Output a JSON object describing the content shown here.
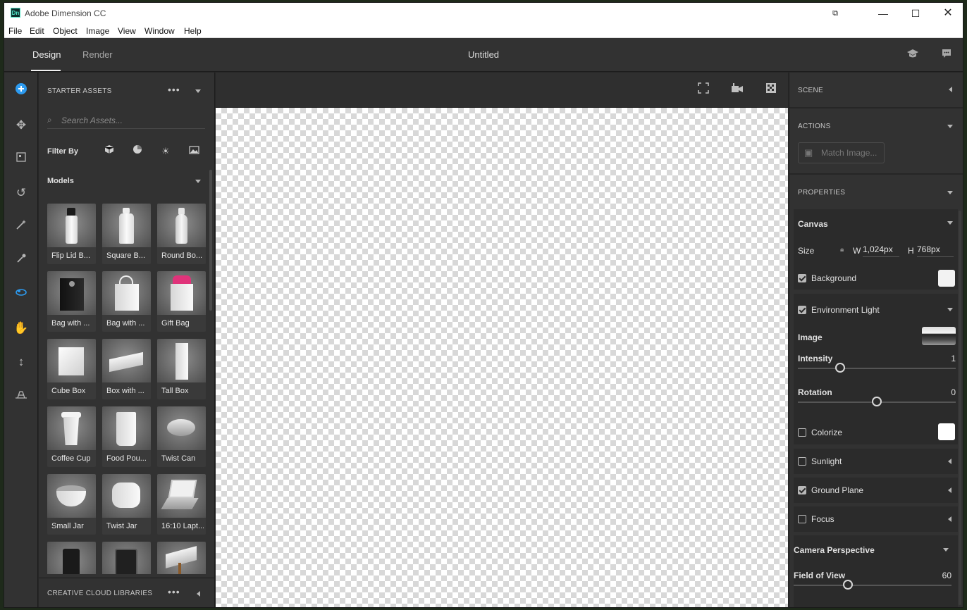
{
  "window": {
    "title": "Adobe Dimension CC",
    "app_badge": "Dn"
  },
  "menu": [
    "File",
    "Edit",
    "Object",
    "Image",
    "View",
    "Window",
    "Help"
  ],
  "header": {
    "tabs": [
      "Design",
      "Render"
    ],
    "document_title": "Untitled"
  },
  "assets": {
    "section_title": "STARTER ASSETS",
    "more": "•••",
    "search_placeholder": "Search Assets...",
    "filter_label": "Filter By",
    "category": "Models",
    "items": [
      {
        "label": "Flip Lid B..."
      },
      {
        "label": "Square B..."
      },
      {
        "label": "Round Bo..."
      },
      {
        "label": "Bag with ..."
      },
      {
        "label": "Bag with ..."
      },
      {
        "label": "Gift Bag"
      },
      {
        "label": "Cube Box"
      },
      {
        "label": "Box with ..."
      },
      {
        "label": "Tall Box"
      },
      {
        "label": "Coffee Cup"
      },
      {
        "label": "Food Pou..."
      },
      {
        "label": "Twist Can"
      },
      {
        "label": "Small Jar"
      },
      {
        "label": "Twist Jar"
      },
      {
        "label": "16:10 Lapt..."
      }
    ],
    "footer_title": "CREATIVE CLOUD LIBRARIES",
    "footer_more": "•••"
  },
  "right": {
    "scene": "SCENE",
    "actions": "ACTIONS",
    "match_image": "Match Image...",
    "properties": "PROPERTIES",
    "canvas": {
      "title": "Canvas",
      "size_label": "Size",
      "w_label": "W",
      "w_value": "1,024px",
      "h_label": "H",
      "h_value": "768px",
      "background_label": "Background",
      "background_checked": true
    },
    "env": {
      "title": "Environment Light",
      "checked": true,
      "image_label": "Image",
      "intensity_label": "Intensity",
      "intensity_value": "1",
      "rotation_label": "Rotation",
      "rotation_value": "0",
      "colorize_label": "Colorize",
      "colorize_checked": false
    },
    "sunlight": {
      "label": "Sunlight",
      "checked": false
    },
    "ground_plane": {
      "label": "Ground Plane",
      "checked": true
    },
    "focus": {
      "label": "Focus",
      "checked": false
    },
    "camera": {
      "title": "Camera Perspective",
      "fov_label": "Field of View",
      "fov_value": "60"
    }
  },
  "colors": {
    "accent": "#2d9bf0",
    "panel": "#323232",
    "workspace": "#262626"
  }
}
